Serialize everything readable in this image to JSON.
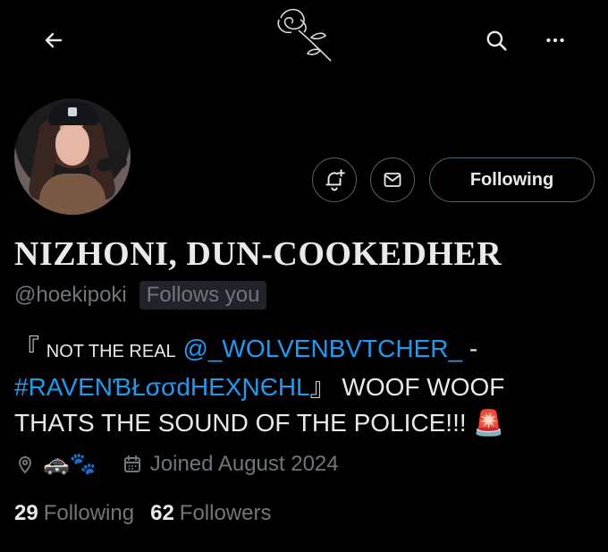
{
  "topbar": {
    "back_icon": "arrow-left-icon",
    "search_icon": "search-icon",
    "more_icon": "more-horizontal-icon",
    "banner_icon": "rose-icon"
  },
  "profile": {
    "display_name": "NIZHONI, DUN-COOKEDHER",
    "handle": "@hoekipoki",
    "follows_you_label": "Follows you",
    "avatar_icon": "profile-avatar"
  },
  "actions": {
    "notify_icon": "bell-plus-icon",
    "message_icon": "mail-icon",
    "following_label": "Following"
  },
  "bio": {
    "open_bracket": "『",
    "lead_text": "NOT THE REAL",
    "mention": "@_WOLVENBVTCHER_",
    "dash": "-",
    "hashtag": "#RAVENƁŁσσdHEXƝЄHL",
    "close_bracket": "』",
    "text": "WOOF WOOF THATS THE SOUND OF THE POLICE!!!",
    "emoji": "🚨"
  },
  "meta": {
    "location_icon": "location-pin-icon",
    "location_emojis": "🚓🐾",
    "calendar_icon": "calendar-icon",
    "joined_text": "Joined August 2024"
  },
  "stats": {
    "following_count": "29",
    "following_label": "Following",
    "followers_count": "62",
    "followers_label": "Followers"
  }
}
